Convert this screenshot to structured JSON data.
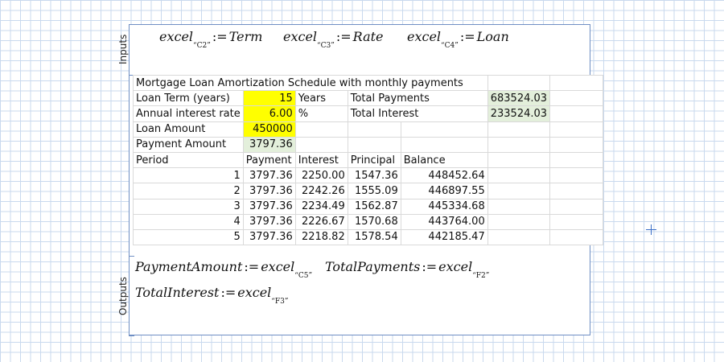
{
  "inputs_label": "Inputs",
  "outputs_label": "Outputs",
  "input_equations": [
    {
      "fn": "excel",
      "sub": "“C2”",
      "op": ":=",
      "var": "Term"
    },
    {
      "fn": "excel",
      "sub": "“C3”",
      "op": ":=",
      "var": "Rate"
    },
    {
      "fn": "excel",
      "sub": "“C4”",
      "op": ":=",
      "var": "Loan"
    }
  ],
  "output_equations": [
    {
      "var": "PaymentAmount",
      "op": ":=",
      "fn": "excel",
      "sub": "“C5”"
    },
    {
      "var": "TotalPayments",
      "op": ":=",
      "fn": "excel",
      "sub": "“F2”"
    },
    {
      "var": "TotalInterest",
      "op": ":=",
      "fn": "excel",
      "sub": "“F3”"
    }
  ],
  "sheet": {
    "title": "Mortgage Loan Amortization Schedule with monthly payments",
    "loan_term_label": "Loan Term (years)",
    "loan_term_value": "15",
    "loan_term_unit": "Years",
    "total_payments_label": "Total Payments",
    "total_payments_value": "683524.03",
    "rate_label": "Annual interest rate",
    "rate_value": "6.00",
    "rate_unit": "%",
    "total_interest_label": "Total Interest",
    "total_interest_value": "233524.03",
    "loan_amount_label": "Loan Amount",
    "loan_amount_value": "450000",
    "payment_amount_label": "Payment Amount",
    "payment_amount_value": "3797.36",
    "headers": [
      "Period",
      "Payment",
      "Interest",
      "Principal",
      "Balance"
    ],
    "rows": [
      [
        "1",
        "3797.36",
        "2250.00",
        "1547.36",
        "448452.64"
      ],
      [
        "2",
        "3797.36",
        "2242.26",
        "1555.09",
        "446897.55"
      ],
      [
        "3",
        "3797.36",
        "2234.49",
        "1562.87",
        "445334.68"
      ],
      [
        "4",
        "3797.36",
        "2226.67",
        "1570.68",
        "443764.00"
      ],
      [
        "5",
        "3797.36",
        "2218.82",
        "1578.54",
        "442185.47"
      ]
    ]
  },
  "colors": {
    "input_highlight": "#ffff00",
    "output_highlight": "#e3efdb",
    "region_border": "#6f8fc4",
    "grid": "#c9d9ee"
  }
}
